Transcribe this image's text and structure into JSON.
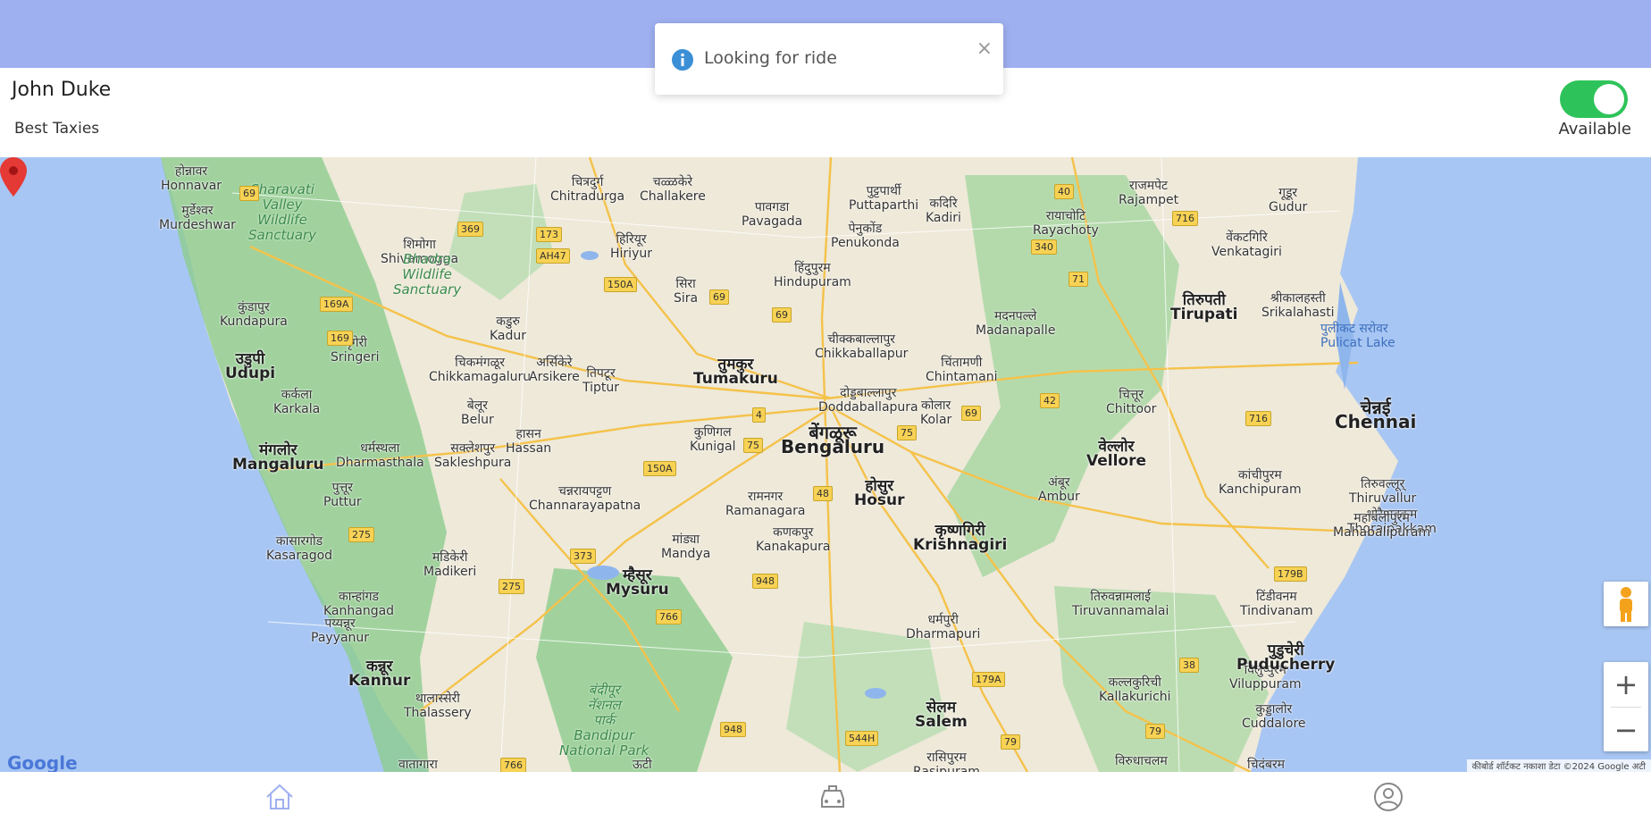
{
  "header": {
    "driver_name": "John Duke",
    "company": "Best Taxies",
    "availability_label": "Available",
    "available": true
  },
  "toast": {
    "message": "Looking for ride",
    "close_symbol": "×"
  },
  "map": {
    "cities": [
      {
        "label": "होन्नावर\nHonnavar"
      },
      {
        "label": "मुर्डेश्वर\nMurdeshwar"
      },
      {
        "label": "चित्रदुर्ग\nChitradurga"
      },
      {
        "label": "चळ्ळकेरे\nChallakere"
      },
      {
        "label": "पुट्टपार्थी\nPuttaparthi"
      },
      {
        "label": "कदिरि\nKadiri"
      },
      {
        "label": "रायाचोटि\nRayachoty"
      },
      {
        "label": "राजमपेट\nRajampet"
      },
      {
        "label": "गूडूर\nGudur"
      },
      {
        "label": "शिमोगा\nShivamogga"
      },
      {
        "label": "हिरियूर\nHiriyur"
      },
      {
        "label": "पावगडा\nPavagada"
      },
      {
        "label": "पेनुकोंड\nPenukonda"
      },
      {
        "label": "वेंकटगिरि\nVenkatagiri"
      },
      {
        "label": "हिंदुपुरम\nHindupuram"
      },
      {
        "label": "सिरा\nSira"
      },
      {
        "label": "कुंडापुर\nKundapura"
      },
      {
        "label": "कडुरु\nKadur"
      },
      {
        "label": "मदनपल्ले\nMadanapalle"
      },
      {
        "label": "श्रीकालहस्ती\nSrikalahasti"
      },
      {
        "label": "श्रृंगेरी\nSringeri"
      },
      {
        "label": "चिकमंगळूर\nChikkamagaluru"
      },
      {
        "label": "अर्सिकेरे\nArsikere"
      },
      {
        "label": "तिपटूर\nTiptur"
      },
      {
        "label": "चीक्कबाल्लापुर\nChikkaballapur"
      },
      {
        "label": "चिंतामणी\nChintamani"
      },
      {
        "label": "कर्कला\nKarkala"
      },
      {
        "label": "बेलूर\nBelur"
      },
      {
        "label": "दोड्डबाल्लापुर\nDoddaballapura"
      },
      {
        "label": "कोलार\nKolar"
      },
      {
        "label": "चित्तूर\nChittoor"
      },
      {
        "label": "धर्मस्थला\nDharmasthala"
      },
      {
        "label": "सक्लेशपुर\nSakleshpura"
      },
      {
        "label": "हासन\nHassan"
      },
      {
        "label": "कुणिगल\nKunigal"
      },
      {
        "label": "कांचीपुरम\nKanchipuram"
      },
      {
        "label": "तिरुवल्लूर्\nThiruvallur"
      },
      {
        "label": "पुत्तूर\nPuttur"
      },
      {
        "label": "चन्नरायपट्टण\nChannarayapatna"
      },
      {
        "label": "रामनगर\nRamanagara"
      },
      {
        "label": "अंबूर\nAmbur"
      },
      {
        "label": "थोरैपाक्कम\nThoraipakkam"
      },
      {
        "label": "महाबलीपुरम\nMahabalipuram"
      },
      {
        "label": "कासारगोड\nKasaragod"
      },
      {
        "label": "मडिकेरी\nMadikeri"
      },
      {
        "label": "मांड्या\nMandya"
      },
      {
        "label": "कणकपुर\nKanakapura"
      },
      {
        "label": "कान्हांगड\nKanhangad"
      },
      {
        "label": "पय्यन्नूर\nPayyanur"
      },
      {
        "label": "धर्मपुरी\nDharmapuri"
      },
      {
        "label": "तिरुवन्नामलाई\nTiruvannamalai"
      },
      {
        "label": "टिंडीवनम\nTindivanam"
      },
      {
        "label": "विलुप्पुरम\nViluppuram"
      },
      {
        "label": "कल्लकुरिची\nKallakurichi"
      },
      {
        "label": "कुड्डालोर\nCuddalore"
      },
      {
        "label": "थालास्सेरी\nThalassery"
      },
      {
        "label": "रासिपुरम\nRasipuram"
      },
      {
        "label": "विरुधाचलम"
      },
      {
        "label": "चिदंबरम"
      },
      {
        "label": "वातागारा"
      },
      {
        "label": "ऊटी"
      }
    ],
    "med_cities": [
      {
        "label": "उडुपी\nUdupi"
      },
      {
        "label": "मंगलोर\nMangaluru"
      },
      {
        "label": "तुमकुर\nTumakuru"
      },
      {
        "label": "होसुर\nHosur"
      },
      {
        "label": "कृष्णगिरी\nKrishnagiri"
      },
      {
        "label": "तिरुपती\nTirupati"
      },
      {
        "label": "वेल्लोर\nVellore"
      },
      {
        "label": "म्हैसूर\nMysuru"
      },
      {
        "label": "कन्नूर\nKannur"
      },
      {
        "label": "सेलम\nSalem"
      },
      {
        "label": "पुडुचेरी\nPuducherry"
      }
    ],
    "big_cities": [
      {
        "label": "बेंगळूरू\nBengaluru"
      },
      {
        "label": "चेन्नई\nChennai"
      }
    ],
    "parks": [
      {
        "label": "Sharavati\nValley\nWildlife\nSanctuary"
      },
      {
        "label": "Bhadra\nWildlife\nSanctuary"
      },
      {
        "label": "बंदीपूर\nनॅशनल\nपार्क\nBandipur\nNational Park"
      }
    ],
    "lakes": [
      {
        "label": "पुलीकट सरोवर\nPulicat Lake"
      }
    ],
    "highways": [
      "69",
      "369",
      "173",
      "AH47",
      "150A",
      "69",
      "69",
      "340",
      "40",
      "716",
      "71",
      "169A",
      "169",
      "4",
      "75",
      "42",
      "69",
      "716",
      "75",
      "150A",
      "48",
      "275",
      "373",
      "948",
      "275",
      "766",
      "179B",
      "38",
      "179A",
      "948",
      "544H",
      "79",
      "79",
      "766"
    ],
    "google_logo": "Google",
    "attribution": "कीबोर्ड शॉर्टकट   नकाशा डेटा ©2024 Google   अटी"
  },
  "bottom_nav": {
    "items": [
      {
        "name": "home",
        "active": true
      },
      {
        "name": "car",
        "active": false
      },
      {
        "name": "profile",
        "active": false
      }
    ]
  },
  "colors": {
    "topbar": "#9fb0f1",
    "toggle_on": "#2ec35a",
    "info_blue": "#3b8fd6",
    "pin_red": "#e53935",
    "nav_active": "#9fb0f1",
    "nav_inactive": "#888888"
  }
}
